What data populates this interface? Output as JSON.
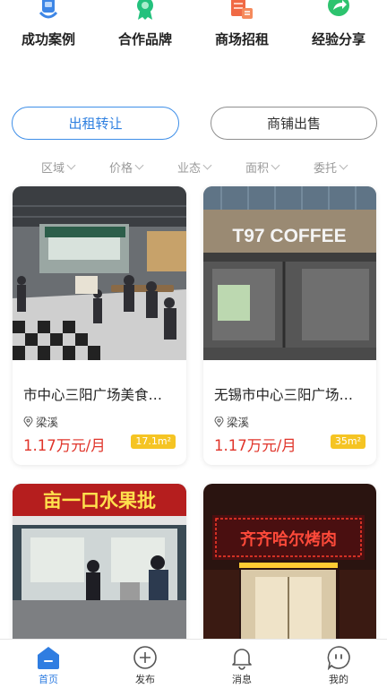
{
  "categories": [
    {
      "label": "成功案例",
      "icon": "success-case-icon"
    },
    {
      "label": "合作品牌",
      "icon": "brand-badge-icon"
    },
    {
      "label": "商场招租",
      "icon": "mall-lease-icon"
    },
    {
      "label": "经验分享",
      "icon": "share-arrow-icon"
    }
  ],
  "buttons": {
    "rent_transfer": "出租转让",
    "shop_sale": "商铺出售"
  },
  "filters": [
    "区域",
    "价格",
    "业态",
    "面积",
    "委托"
  ],
  "listings": [
    {
      "title": "市中心三阳广场美食城优质铺位招租",
      "location": "梁溪",
      "price": "1.17万元/月",
      "area": "17.1m²",
      "photo": "food-court-photo"
    },
    {
      "title": "无锡市中心三阳广场临街咖啡铺",
      "location": "梁溪",
      "price": "1.17万元/月",
      "area": "35m²",
      "photo": "coffee-shop-photo",
      "sign_text": "T97 COFFEE"
    },
    {
      "photo": "fruit-shop-photo",
      "sign_text": "亩一口水果批"
    },
    {
      "photo": "bbq-restaurant-photo",
      "sign_text": "齐齐哈尔烤肉"
    }
  ],
  "tabbar": [
    {
      "label": "首页",
      "icon": "home-icon",
      "active": true
    },
    {
      "label": "发布",
      "icon": "publish-plus-icon",
      "active": false
    },
    {
      "label": "消息",
      "icon": "bell-icon",
      "active": false
    },
    {
      "label": "我的",
      "icon": "profile-face-icon",
      "active": false
    }
  ],
  "colors": {
    "accent": "#2f7de1",
    "price": "#e0342a",
    "area_badge": "#f5c423"
  }
}
